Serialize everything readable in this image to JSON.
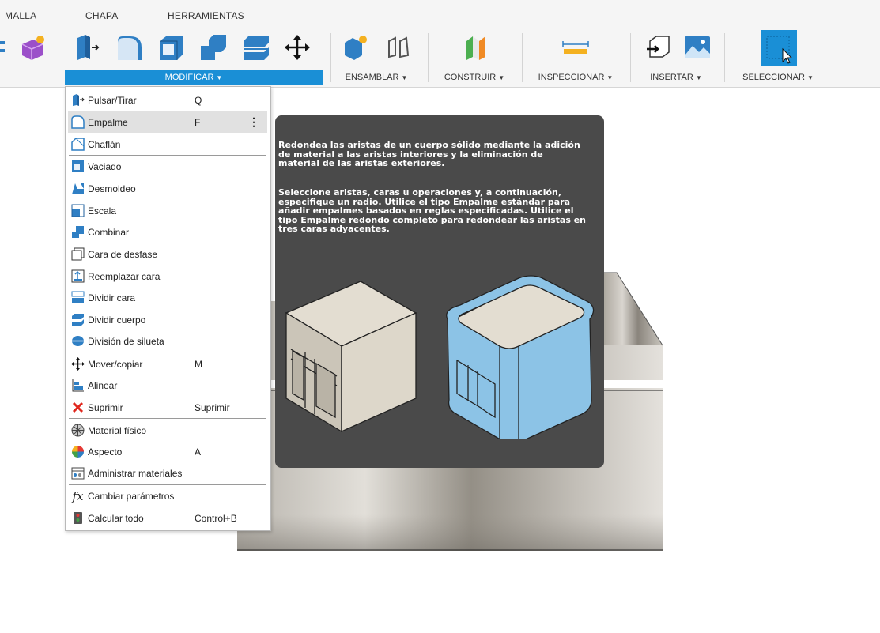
{
  "tabs": [
    "MALLA",
    "CHAPA",
    "HERRAMIENTAS"
  ],
  "panels": {
    "modificar": "MODIFICAR",
    "ensamblar": "ENSAMBLAR",
    "construir": "CONSTRUIR",
    "inspeccionar": "INSPECCIONAR",
    "insertar": "INSERTAR",
    "seleccionar": "SELECCIONAR"
  },
  "menu": [
    {
      "label": "Pulsar/Tirar",
      "shortcut": "Q",
      "icon": "press-pull-icon"
    },
    {
      "label": "Empalme",
      "shortcut": "F",
      "icon": "fillet-icon",
      "highlighted": true
    },
    {
      "label": "Chaflán",
      "shortcut": "",
      "icon": "chamfer-icon"
    },
    {
      "label": "Vaciado",
      "shortcut": "",
      "icon": "shell-icon"
    },
    {
      "label": "Desmoldeo",
      "shortcut": "",
      "icon": "draft-icon"
    },
    {
      "label": "Escala",
      "shortcut": "",
      "icon": "scale-icon"
    },
    {
      "label": "Combinar",
      "shortcut": "",
      "icon": "combine-icon"
    },
    {
      "label": "Cara de desfase",
      "shortcut": "",
      "icon": "offset-face-icon"
    },
    {
      "label": "Reemplazar cara",
      "shortcut": "",
      "icon": "replace-face-icon"
    },
    {
      "label": "Dividir cara",
      "shortcut": "",
      "icon": "split-face-icon"
    },
    {
      "label": "Dividir cuerpo",
      "shortcut": "",
      "icon": "split-body-icon"
    },
    {
      "label": "División de silueta",
      "shortcut": "",
      "icon": "silhouette-split-icon"
    },
    {
      "label": "Mover/copiar",
      "shortcut": "M",
      "icon": "move-icon"
    },
    {
      "label": "Alinear",
      "shortcut": "",
      "icon": "align-icon"
    },
    {
      "label": "Suprimir",
      "shortcut": "Suprimir",
      "icon": "delete-icon"
    },
    {
      "label": "Material físico",
      "shortcut": "",
      "icon": "physical-material-icon"
    },
    {
      "label": "Aspecto",
      "shortcut": "A",
      "icon": "appearance-icon"
    },
    {
      "label": "Administrar materiales",
      "shortcut": "",
      "icon": "manage-materials-icon"
    },
    {
      "label": "Cambiar parámetros",
      "shortcut": "",
      "icon": "parameters-icon"
    },
    {
      "label": "Calcular todo",
      "shortcut": "Control+B",
      "icon": "compute-all-icon"
    }
  ],
  "tooltip": {
    "p1": "Redondea las aristas de un cuerpo sólido mediante la adición de material a las aristas interiores y la eliminación de material de las aristas exteriores.",
    "p2": "Seleccione aristas, caras u operaciones y, a continuación, especifique un radio. Utilice el tipo Empalme estándar para añadir empalmes basados en reglas especificadas. Utilice el tipo Empalme redondo completo para redondear las aristas en tres caras adyacentes."
  },
  "colors": {
    "accent": "#1a8fd6",
    "tooltip_bg": "#4a4a4a",
    "highlight": "#e1e1e1",
    "fillet_blue": "#8cc3e6"
  }
}
